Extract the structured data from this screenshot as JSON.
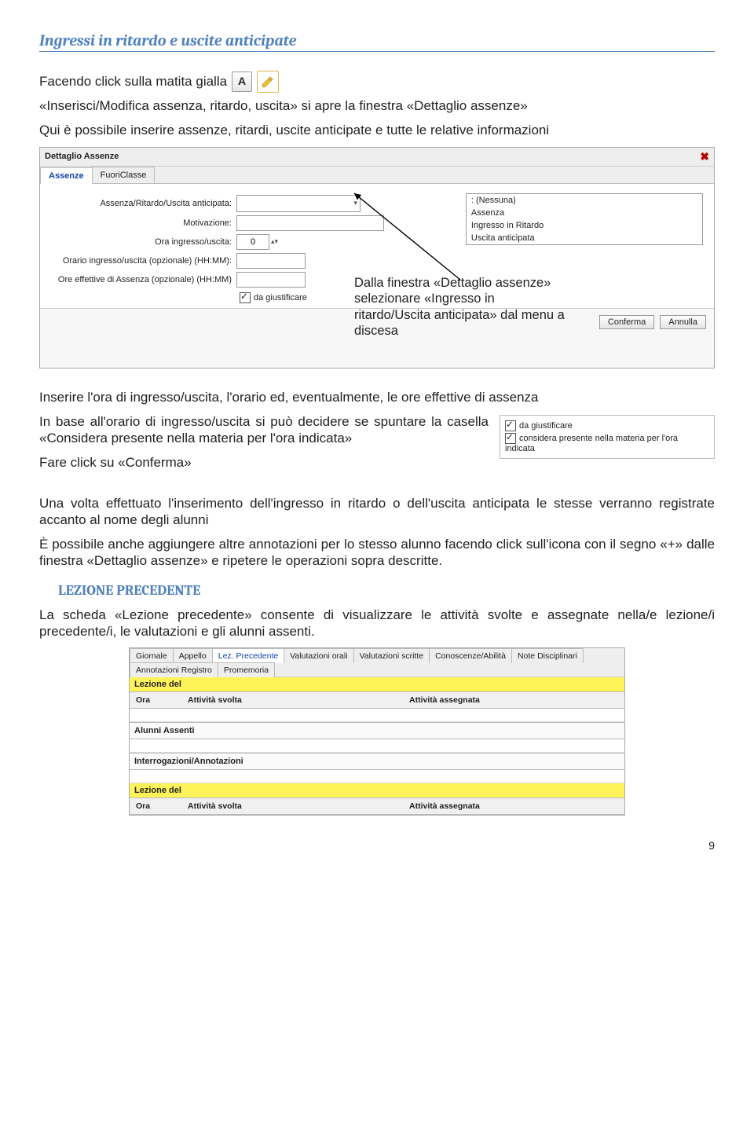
{
  "h1": "Ingressi in ritardo e uscite anticipate",
  "p1a": "Facendo click sulla matita gialla",
  "iconA": "A",
  "p1b": "«Inserisci/Modifica assenza, ritardo, uscita» si apre la finestra «Dettaglio assenze»",
  "p2": "Qui è possibile inserire assenze, ritardi, uscite anticipate e tutte le relative informazioni",
  "shot1": {
    "title": "Dettaglio Assenze",
    "tab1": "Assenze",
    "tab2": "FuoriClasse",
    "l1": "Assenza/Ritardo/Uscita anticipata:",
    "l2": "Motivazione:",
    "l3": "Ora ingresso/uscita:",
    "l3v": "0",
    "l4": "Orario ingresso/uscita (opzionale) (HH:MM):",
    "l5": "Ore effettive di Assenza (opzionale) (HH:MM)",
    "dd_sel": ": (Nessuna)",
    "dd_o1": "Assenza",
    "dd_o2": "Ingresso in Ritardo",
    "dd_o3": "Uscita anticipata",
    "chk": "da giustificare",
    "btn1": "Conferma",
    "btn2": "Annulla"
  },
  "callout": "Dalla finestra «Dettaglio assenze» selezionare «Ingresso in ritardo/Uscita anticipata» dal menu a discesa",
  "p3": "Inserire l'ora di ingresso/uscita, l'orario ed, eventualmente, le ore effettive di assenza",
  "p4": "In base all'orario di ingresso/uscita si può decidere se spuntare la casella «Considera presente nella materia per l'ora indicata»",
  "p5": "Fare click su «Conferma»",
  "mini": {
    "c1": "da giustificare",
    "c2": "considera presente nella materia per l'ora indicata"
  },
  "p6": "Una volta effettuato l'inserimento dell'ingresso in ritardo o dell'uscita anticipata le stesse verranno registrate accanto al nome degli alunni",
  "p7": "È possibile anche aggiungere altre annotazioni per lo stesso alunno facendo click sull'icona con il segno «+» dalle finestra «Dettaglio assenze» e ripetere le operazioni sopra descritte.",
  "h2": "LEZIONE PRECEDENTE",
  "p8": "La scheda «Lezione precedente» consente di visualizzare le attività svolte e assegnate nella/e lezione/i precedente/i, le valutazioni e gli alunni assenti.",
  "lez": {
    "t1": "Giornale",
    "t2": "Appello",
    "t3": "Lez. Precedente",
    "t4": "Valutazioni orali",
    "t5": "Valutazioni scritte",
    "t6": "Conoscenze/Abilità",
    "t7": "Note Disciplinari",
    "t8": "Annotazioni Registro",
    "t9": "Promemoria",
    "lezdel": "Lezione del",
    "ora": "Ora",
    "as": "Attività svolta",
    "aa": "Attività assegnata",
    "alas": "Alunni Assenti",
    "inter": "Interrogazioni/Annotazioni"
  },
  "pagenum": "9"
}
